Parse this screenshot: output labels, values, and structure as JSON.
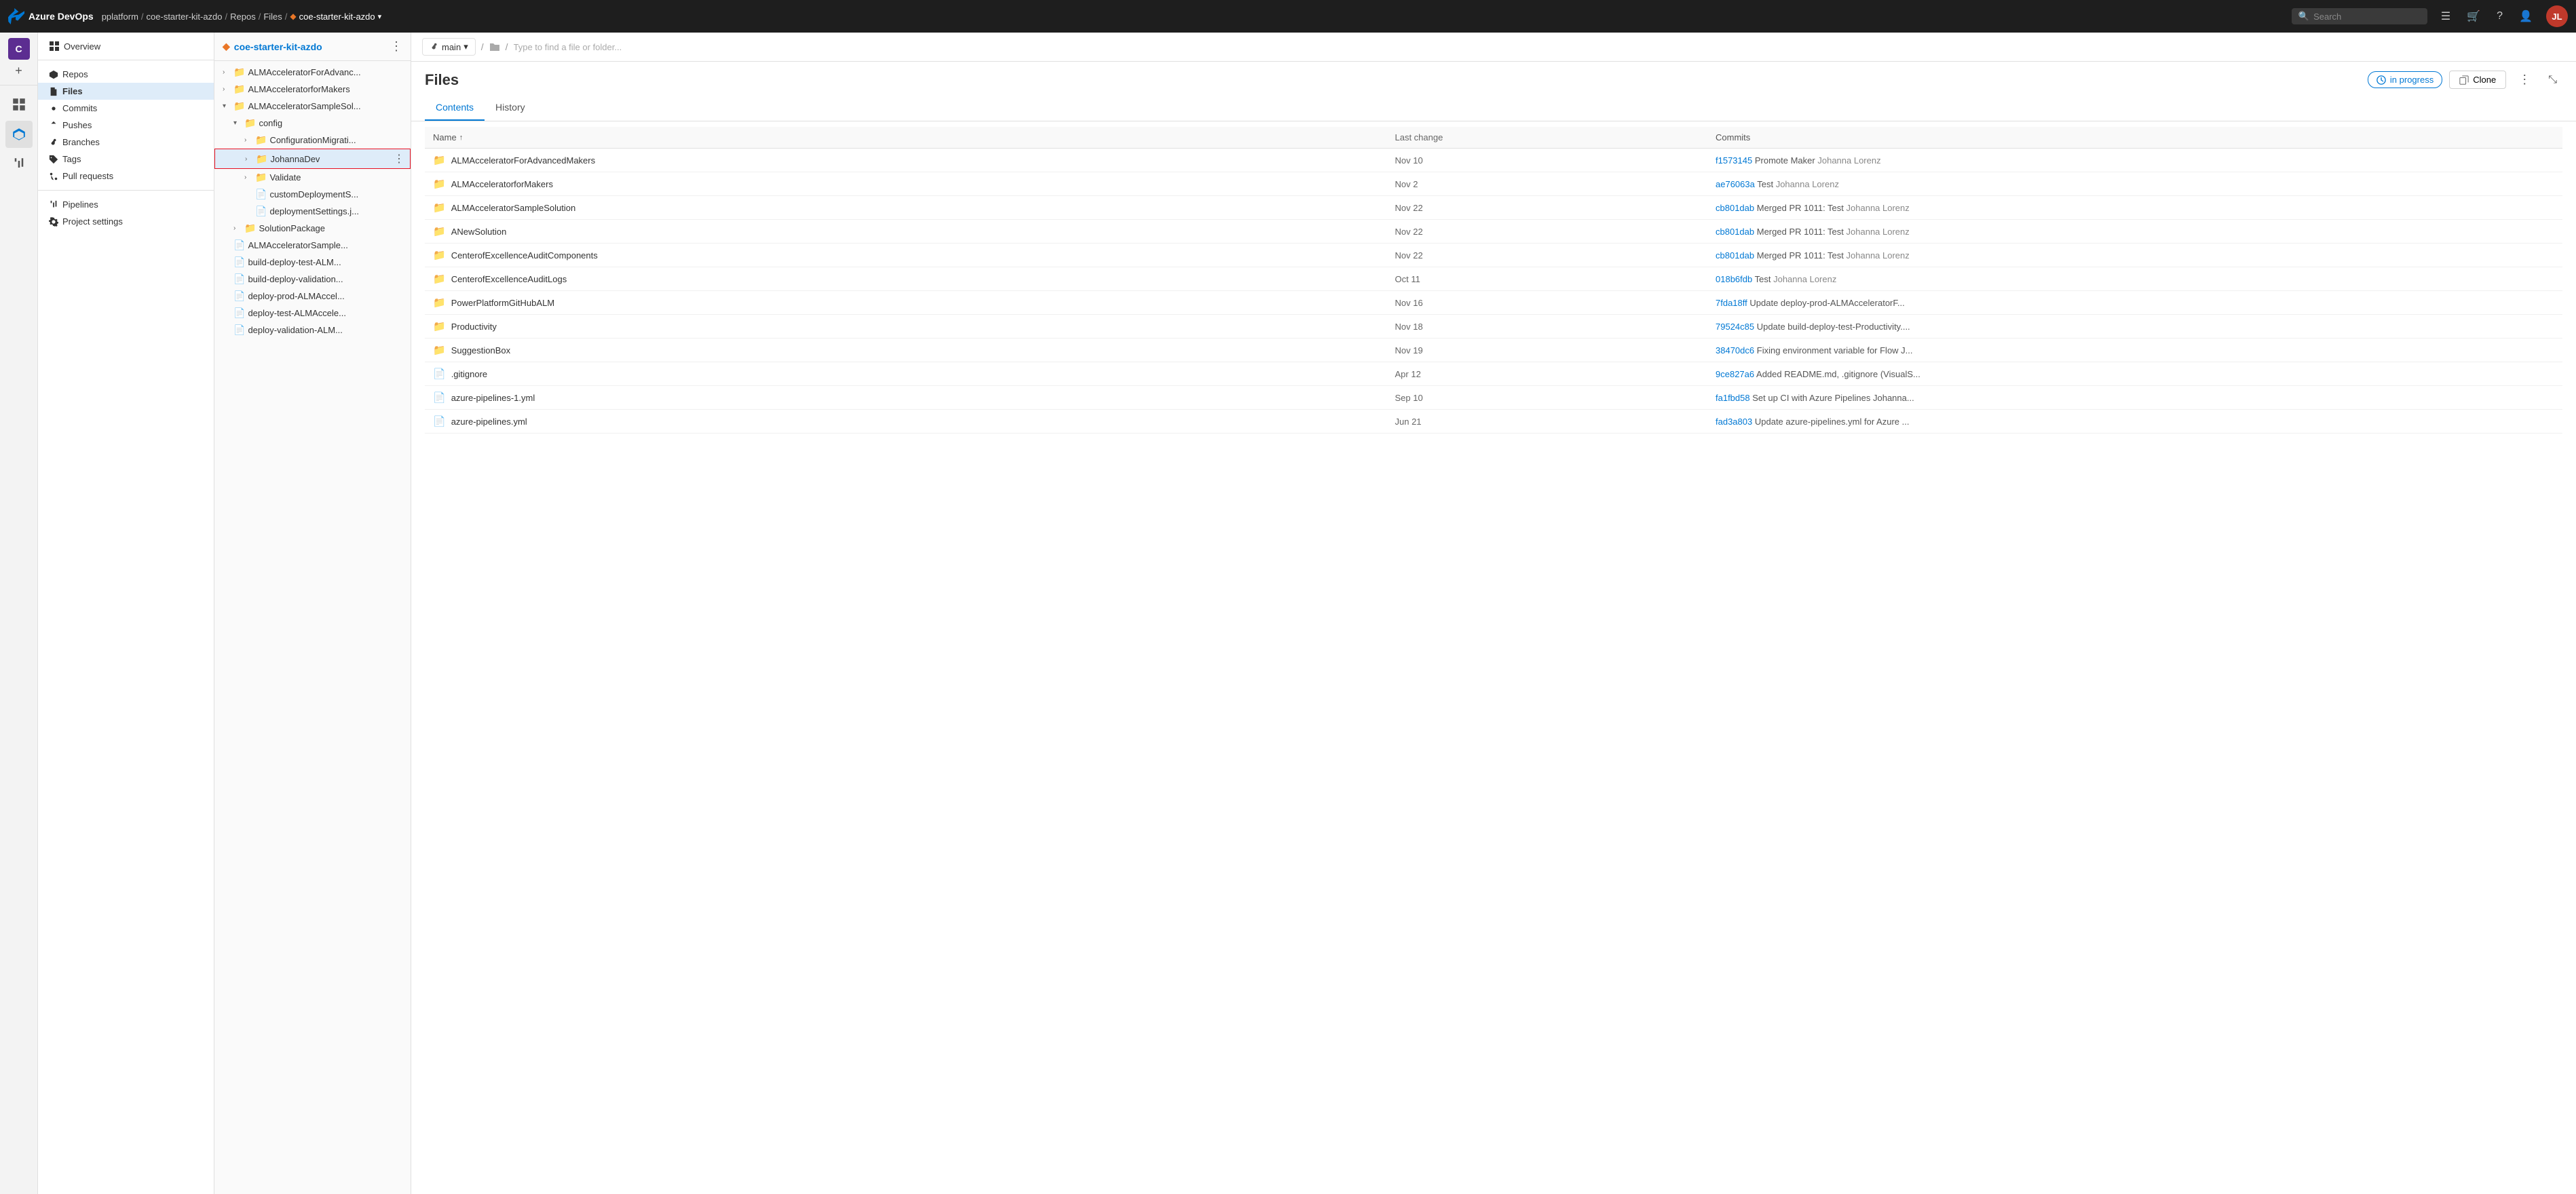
{
  "app": {
    "name": "Azure DevOps",
    "logo_color": "#0078d4"
  },
  "topnav": {
    "breadcrumbs": [
      {
        "label": "pplatform",
        "href": "#"
      },
      {
        "label": "coe-starter-kit-azdo",
        "href": "#"
      },
      {
        "label": "Repos",
        "href": "#"
      },
      {
        "label": "Files",
        "href": "#"
      },
      {
        "label": "coe-starter-kit-azdo",
        "href": "#",
        "has_diamond": true
      }
    ],
    "search_placeholder": "Search",
    "user_initials": "JL"
  },
  "left_sidebar": {
    "items": [
      {
        "name": "organization-icon",
        "icon": "org",
        "label": "Organization"
      },
      {
        "name": "overview-nav",
        "icon": "overview",
        "label": "Overview"
      },
      {
        "name": "repos-nav",
        "icon": "repos",
        "label": "Repos",
        "active": true
      },
      {
        "name": "pipelines-nav",
        "icon": "pipelines",
        "label": "Pipelines"
      }
    ]
  },
  "repo_nav": {
    "project": "coe-starter-kit-azdo",
    "items": [
      {
        "label": "Overview",
        "name": "overview-item"
      },
      {
        "label": "Repos",
        "name": "repos-item",
        "active": false
      },
      {
        "label": "Files",
        "name": "files-item",
        "active": true
      },
      {
        "label": "Commits",
        "name": "commits-item"
      },
      {
        "label": "Pushes",
        "name": "pushes-item"
      },
      {
        "label": "Branches",
        "name": "branches-item"
      },
      {
        "label": "Tags",
        "name": "tags-item"
      },
      {
        "label": "Pull requests",
        "name": "pull-requests-item"
      },
      {
        "label": "Pipelines",
        "name": "pipelines-item"
      }
    ]
  },
  "file_tree": {
    "repo_name": "coe-starter-kit-azdo",
    "items": [
      {
        "level": 0,
        "type": "folder",
        "name": "ALMAcceleratorForAdvanc...",
        "expanded": false,
        "id": "alm-advanc"
      },
      {
        "level": 0,
        "type": "folder",
        "name": "ALMAcceleratorforMakers",
        "expanded": false,
        "id": "alm-makers"
      },
      {
        "level": 0,
        "type": "folder",
        "name": "ALMAcceleratorSampleSol...",
        "expanded": true,
        "id": "alm-sample"
      },
      {
        "level": 1,
        "type": "folder",
        "name": "config",
        "expanded": true,
        "id": "config"
      },
      {
        "level": 2,
        "type": "folder",
        "name": "ConfigurationMigrati...",
        "expanded": false,
        "id": "config-migr"
      },
      {
        "level": 2,
        "type": "folder",
        "name": "JohannaDev",
        "expanded": false,
        "id": "johannadev",
        "selected": true
      },
      {
        "level": 2,
        "type": "folder",
        "name": "Validate",
        "expanded": false,
        "id": "validate"
      },
      {
        "level": 2,
        "type": "file",
        "name": "customDeploymentS...",
        "id": "custom-deploy"
      },
      {
        "level": 2,
        "type": "file",
        "name": "deploymentSettings.j...",
        "id": "deploy-settings"
      },
      {
        "level": 1,
        "type": "folder",
        "name": "SolutionPackage",
        "expanded": false,
        "id": "solution-pkg"
      },
      {
        "level": 0,
        "type": "file",
        "name": "ALMAcceleratorSample...",
        "id": "alm-sample-file"
      },
      {
        "level": 0,
        "type": "file",
        "name": "build-deploy-test-ALM...",
        "id": "build-deploy-test"
      },
      {
        "level": 0,
        "type": "file",
        "name": "build-deploy-validation...",
        "id": "build-deploy-val"
      },
      {
        "level": 0,
        "type": "file",
        "name": "deploy-prod-ALMAccel...",
        "id": "deploy-prod"
      },
      {
        "level": 0,
        "type": "file",
        "name": "deploy-test-ALMAccele...",
        "id": "deploy-test"
      },
      {
        "level": 0,
        "type": "file",
        "name": "deploy-validation-ALM...",
        "id": "deploy-val"
      }
    ]
  },
  "subheader": {
    "branch": "main",
    "path_placeholder": "Type to find a file or folder..."
  },
  "files_page": {
    "title": "Files",
    "tabs": [
      {
        "label": "Contents",
        "active": true
      },
      {
        "label": "History",
        "active": false
      }
    ],
    "in_progress_label": "in progress",
    "clone_label": "Clone",
    "columns": [
      {
        "label": "Name",
        "sort": true,
        "name": "name-col"
      },
      {
        "label": "Last change",
        "name": "last-change-col"
      },
      {
        "label": "Commits",
        "name": "commits-col"
      }
    ],
    "rows": [
      {
        "type": "folder",
        "name": "ALMAcceleratorForAdvancedMakers",
        "last_change": "Nov 10",
        "commit_hash": "f1573145",
        "commit_msg": "Promote Maker",
        "commit_author": "Johanna Lorenz"
      },
      {
        "type": "folder",
        "name": "ALMAcceleratorforMakers",
        "last_change": "Nov 2",
        "commit_hash": "ae76063a",
        "commit_msg": "Test",
        "commit_author": "Johanna Lorenz"
      },
      {
        "type": "folder",
        "name": "ALMAcceleratorSampleSolution",
        "last_change": "Nov 22",
        "commit_hash": "cb801dab",
        "commit_msg": "Merged PR 1011: Test",
        "commit_author": "Johanna Lorenz"
      },
      {
        "type": "folder",
        "name": "ANewSolution",
        "last_change": "Nov 22",
        "commit_hash": "cb801dab",
        "commit_msg": "Merged PR 1011: Test",
        "commit_author": "Johanna Lorenz"
      },
      {
        "type": "folder",
        "name": "CenterofExcellenceAuditComponents",
        "last_change": "Nov 22",
        "commit_hash": "cb801dab",
        "commit_msg": "Merged PR 1011: Test",
        "commit_author": "Johanna Lorenz"
      },
      {
        "type": "folder",
        "name": "CenterofExcellenceAuditLogs",
        "last_change": "Oct 11",
        "commit_hash": "018b6fdb",
        "commit_msg": "Test",
        "commit_author": "Johanna Lorenz"
      },
      {
        "type": "folder",
        "name": "PowerPlatformGitHubALM",
        "last_change": "Nov 16",
        "commit_hash": "7fda18ff",
        "commit_msg": "Update deploy-prod-ALMAcceleratorF...",
        "commit_author": ""
      },
      {
        "type": "folder",
        "name": "Productivity",
        "last_change": "Nov 18",
        "commit_hash": "79524c85",
        "commit_msg": "Update build-deploy-test-Productivity....",
        "commit_author": ""
      },
      {
        "type": "folder",
        "name": "SuggestionBox",
        "last_change": "Nov 19",
        "commit_hash": "38470dc6",
        "commit_msg": "Fixing environment variable for Flow J...",
        "commit_author": ""
      },
      {
        "type": "file",
        "name": ".gitignore",
        "last_change": "Apr 12",
        "commit_hash": "9ce827a6",
        "commit_msg": "Added README.md, .gitignore (VisualS...",
        "commit_author": ""
      },
      {
        "type": "file",
        "name": "azure-pipelines-1.yml",
        "last_change": "Sep 10",
        "commit_hash": "fa1fbd58",
        "commit_msg": "Set up CI with Azure Pipelines Johanna...",
        "commit_author": ""
      },
      {
        "type": "file",
        "name": "azure-pipelines.yml",
        "last_change": "Jun 21",
        "commit_hash": "fad3a803",
        "commit_msg": "Update azure-pipelines.yml for Azure ...",
        "commit_author": ""
      }
    ]
  }
}
